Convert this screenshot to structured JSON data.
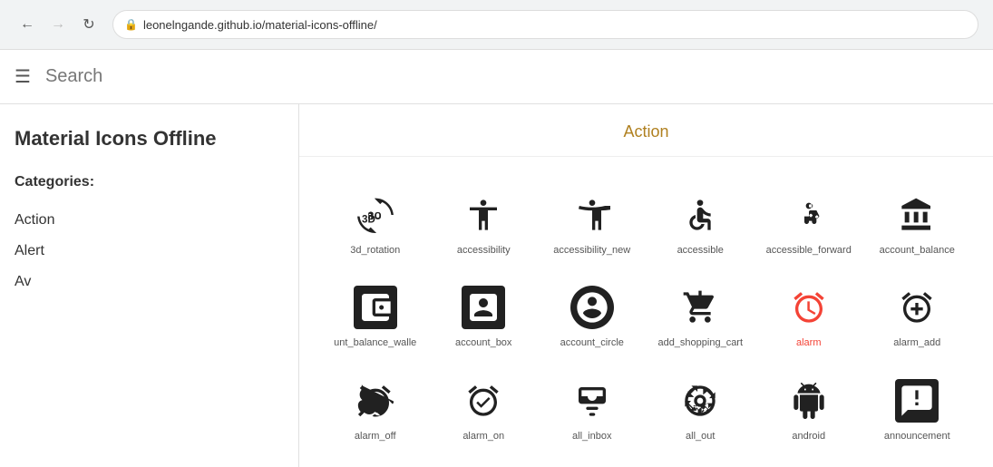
{
  "browser": {
    "url": "leonelngande.github.io/material-icons-offline/",
    "back_disabled": false,
    "forward_disabled": false
  },
  "header": {
    "menu_icon": "☰",
    "search_label": "Search"
  },
  "sidebar": {
    "title": "Material Icons Offline",
    "categories_label": "Categories:",
    "items": [
      {
        "label": "Action"
      },
      {
        "label": "Alert"
      },
      {
        "label": "Av"
      }
    ]
  },
  "content": {
    "category_title": "Action",
    "icons": [
      {
        "name": "3d_rotation",
        "type": "3d_rotation"
      },
      {
        "name": "accessibility",
        "type": "accessibility"
      },
      {
        "name": "accessibility_new",
        "type": "accessibility_new"
      },
      {
        "name": "accessible",
        "type": "accessible"
      },
      {
        "name": "accessible_forward",
        "type": "accessible_forward"
      },
      {
        "name": "account_balance",
        "type": "account_balance"
      },
      {
        "name": "account_balance_wallet",
        "type": "account_balance_wallet",
        "truncated": "unt_balance_walle"
      },
      {
        "name": "account_box",
        "type": "account_box"
      },
      {
        "name": "account_circle",
        "type": "account_circle"
      },
      {
        "name": "add_shopping_cart",
        "type": "add_shopping_cart"
      },
      {
        "name": "alarm",
        "type": "alarm",
        "colored": true
      },
      {
        "name": "alarm_add",
        "type": "alarm_add"
      },
      {
        "name": "alarm_off",
        "type": "alarm_off"
      },
      {
        "name": "alarm_on",
        "type": "alarm_on"
      },
      {
        "name": "all_inbox",
        "type": "all_inbox"
      },
      {
        "name": "all_out",
        "type": "all_out"
      },
      {
        "name": "android",
        "type": "android"
      },
      {
        "name": "announcement",
        "type": "announcement"
      }
    ]
  }
}
